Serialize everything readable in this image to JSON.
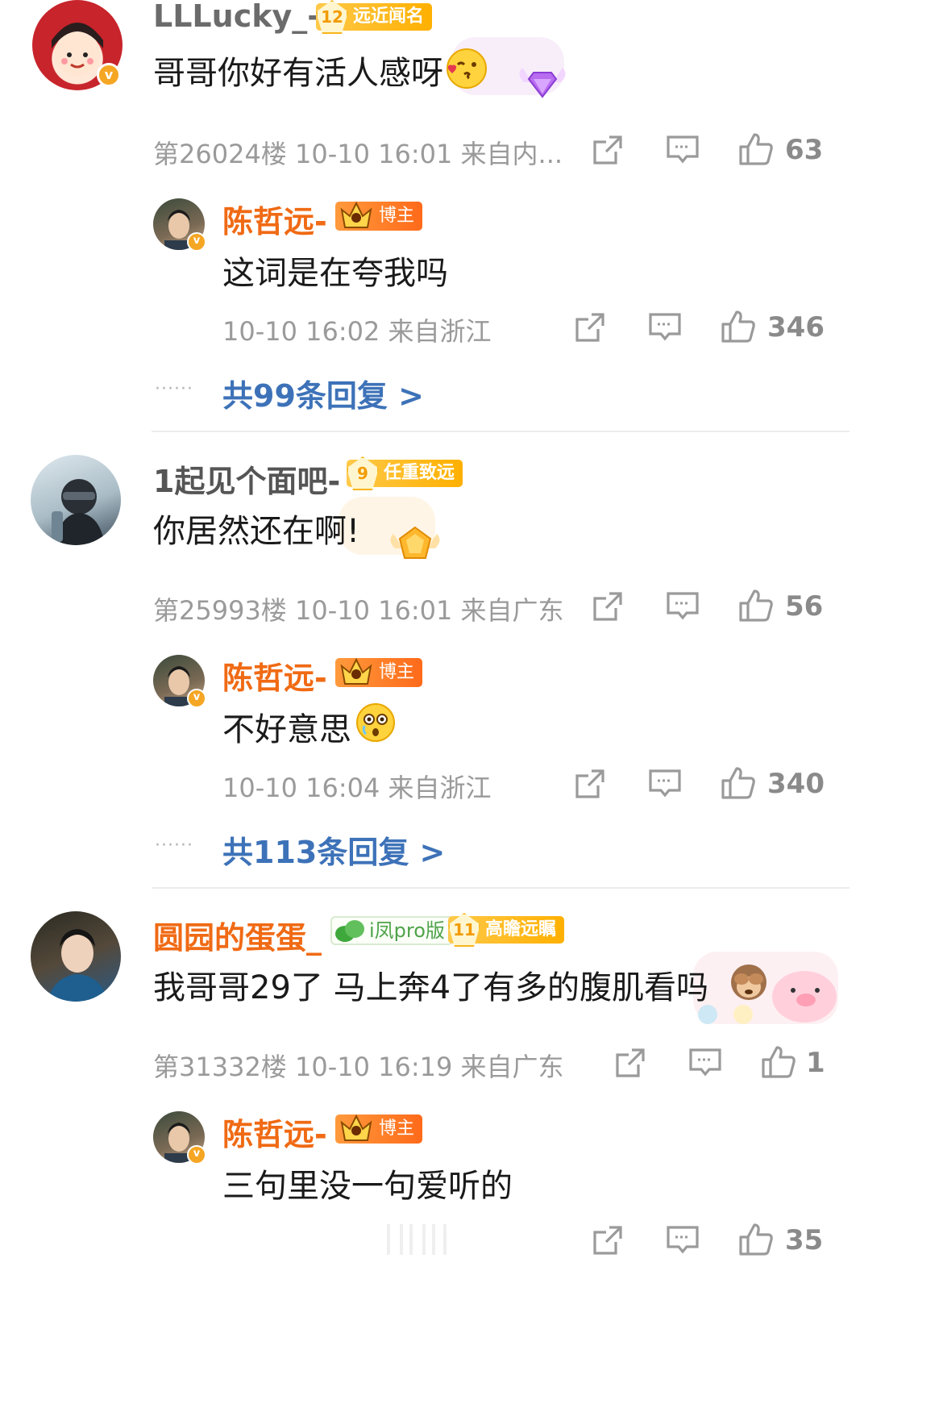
{
  "comments": [
    {
      "username": "LLLucky_-",
      "badge": {
        "level": "12",
        "label": "远近闻名"
      },
      "text": "哥哥你好有活人感呀",
      "meta": "第26024楼 10-10 16:01 来自内...",
      "likes": "63",
      "reply": {
        "username": "陈哲远-",
        "role_badge": "博主",
        "text": "这词是在夸我吗",
        "meta": "10-10 16:02 来自浙江",
        "likes": "346"
      },
      "more_replies": "共99条回复 >"
    },
    {
      "username": "1起见个面吧-",
      "badge": {
        "level": "9",
        "label": "任重致远"
      },
      "text": "你居然还在啊!",
      "meta": "第25993楼 10-10 16:01 来自广东",
      "likes": "56",
      "reply": {
        "username": "陈哲远-",
        "role_badge": "博主",
        "text": "不好意思",
        "meta": "10-10 16:04 来自浙江",
        "likes": "340"
      },
      "more_replies": "共113条回复 >"
    },
    {
      "username": "圆园的蛋蛋_",
      "pro_badge": "i凤pro版",
      "badge": {
        "level": "11",
        "label": "高瞻远瞩"
      },
      "text": "我哥哥29了 马上奔4了有多的腹肌看吗",
      "meta": "第31332楼 10-10 16:19 来自广东",
      "likes": "1",
      "reply": {
        "username": "陈哲远-",
        "role_badge": "博主",
        "text": "三句里没一句爱听的",
        "likes": "35"
      }
    }
  ],
  "verified_mark": "v",
  "dots": "······",
  "colors": {
    "username_gray": "#6b6b6b",
    "blogger_orange": "#f06a14",
    "link_blue": "#3d72b8",
    "meta_gray": "#9a9a9a",
    "badge_gold": "#ffb000"
  },
  "icons": [
    "share-icon",
    "comment-icon",
    "like-icon",
    "kiss-emoji",
    "shocked-emoji",
    "see-no-evil-monkey-emoji",
    "diamond-decoration",
    "crown-icon",
    "leaf-icon"
  ]
}
